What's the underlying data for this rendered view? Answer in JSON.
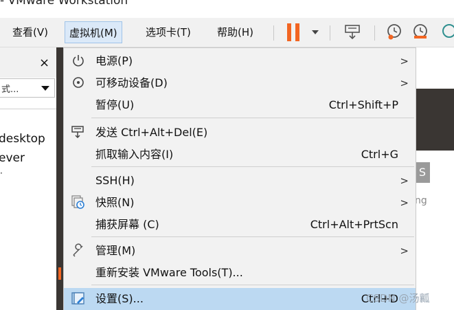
{
  "window": {
    "title": "- VMware Workstation"
  },
  "menubar": {
    "items": [
      {
        "label": "查看(V)"
      },
      {
        "label": "虚拟机(M)"
      },
      {
        "label": "选项卡(T)"
      },
      {
        "label": "帮助(H)"
      }
    ]
  },
  "toolbar": {
    "icons": [
      "pause-icon",
      "dropdown-icon",
      "send-ctrl-alt-del-icon",
      "snapshot-icon",
      "revert-snapshot-icon",
      "manage-snapshot-icon"
    ],
    "accent_color": "#f26522"
  },
  "library": {
    "close": "×",
    "search_value": "式...",
    "rows": [
      "desktop",
      "ever",
      "·"
    ]
  },
  "right_pane": {
    "tab_text": "S",
    "text": "ng"
  },
  "vm_menu": {
    "items": [
      {
        "label": "电源(P)",
        "shortcut": "",
        "submenu": true,
        "icon": "power-icon"
      },
      {
        "label": "可移动设备(D)",
        "shortcut": "",
        "submenu": true,
        "icon": "removable-device-icon"
      },
      {
        "label": "暂停(U)",
        "shortcut": "Ctrl+Shift+P",
        "submenu": false,
        "icon": ""
      },
      {
        "label": "发送 Ctrl+Alt+Del(E)",
        "shortcut": "",
        "submenu": false,
        "icon": "send-keys-icon"
      },
      {
        "label": "抓取输入内容(I)",
        "shortcut": "Ctrl+G",
        "submenu": false,
        "icon": ""
      },
      {
        "label": "SSH(H)",
        "shortcut": "",
        "submenu": true,
        "icon": ""
      },
      {
        "label": "快照(N)",
        "shortcut": "",
        "submenu": true,
        "icon": "snapshot-icon"
      },
      {
        "label": "捕获屏幕 (C)",
        "shortcut": "Ctrl+Alt+PrtScn",
        "submenu": false,
        "icon": ""
      },
      {
        "label": "管理(M)",
        "shortcut": "",
        "submenu": true,
        "icon": "wrench-icon"
      },
      {
        "label": "重新安装 VMware Tools(T)...",
        "shortcut": "",
        "submenu": false,
        "icon": ""
      },
      {
        "label": "设置(S)...",
        "shortcut": "Ctrl+D",
        "submenu": false,
        "icon": "settings-icon",
        "highlighted": true
      }
    ],
    "submenu_arrow": ">"
  },
  "watermark": "CSDN @汤瓤"
}
